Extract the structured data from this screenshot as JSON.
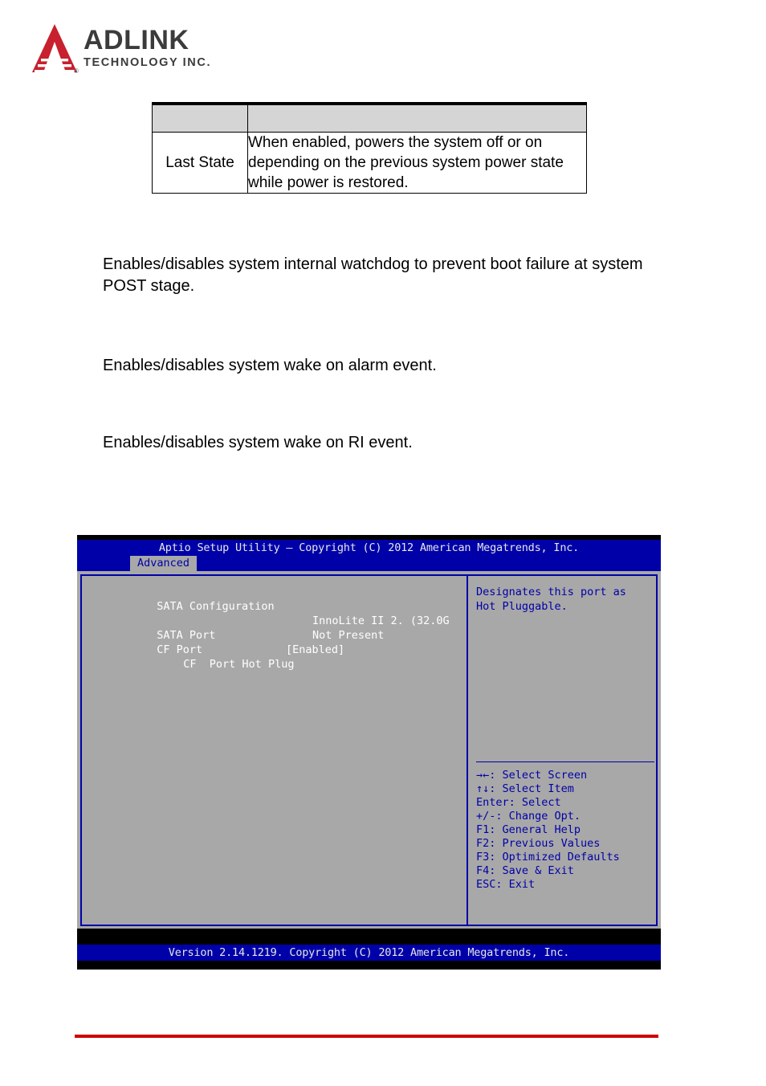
{
  "brand": {
    "name": "ADLINK",
    "tagline": "TECHNOLOGY INC.",
    "registered_mark": "®",
    "logo_color": "#c8202e",
    "text_color": "#3b3b3b"
  },
  "table": {
    "header": {
      "term": "",
      "description": ""
    },
    "rows": [
      {
        "term": "Last State",
        "description": "When enabled, powers the system off or on depending on the previous system power state while power is restored."
      }
    ]
  },
  "paragraphs": [
    "Enables/disables system internal watchdog to prevent boot failure at system POST stage.",
    "Enables/disables system wake on alarm event.",
    "Enables/disables system wake on RI event."
  ],
  "bios": {
    "title": "Aptio Setup Utility – Copyright (C) 2012 American Megatrends, Inc.",
    "active_tab": "Advanced",
    "section_title": "SATA Configuration",
    "settings": [
      {
        "label": "SATA Port",
        "value": "InnoLite II 2. (32.0G",
        "indent": 0
      },
      {
        "label": "CF Port",
        "value": "Not Present",
        "indent": 0
      },
      {
        "label": "CF  Port Hot Plug",
        "value": "[Enabled]",
        "indent": 1
      }
    ],
    "help_text": "Designates this port as Hot Pluggable.",
    "key_legend": [
      "→←: Select Screen",
      "↑↓: Select Item",
      "Enter: Select",
      "+/-: Change Opt.",
      "F1: General Help",
      "F2: Previous Values",
      "F3: Optimized Defaults",
      "F4: Save & Exit",
      "ESC: Exit"
    ],
    "footer": "Version 2.14.1219. Copyright (C) 2012 American Megatrends, Inc.",
    "colors": {
      "header_blue": "#0000a8",
      "panel_gray": "#a8a8a8",
      "text_white": "#ffffff",
      "text_blue": "#0000a8"
    }
  },
  "footer_rule_color": "#cc0000"
}
